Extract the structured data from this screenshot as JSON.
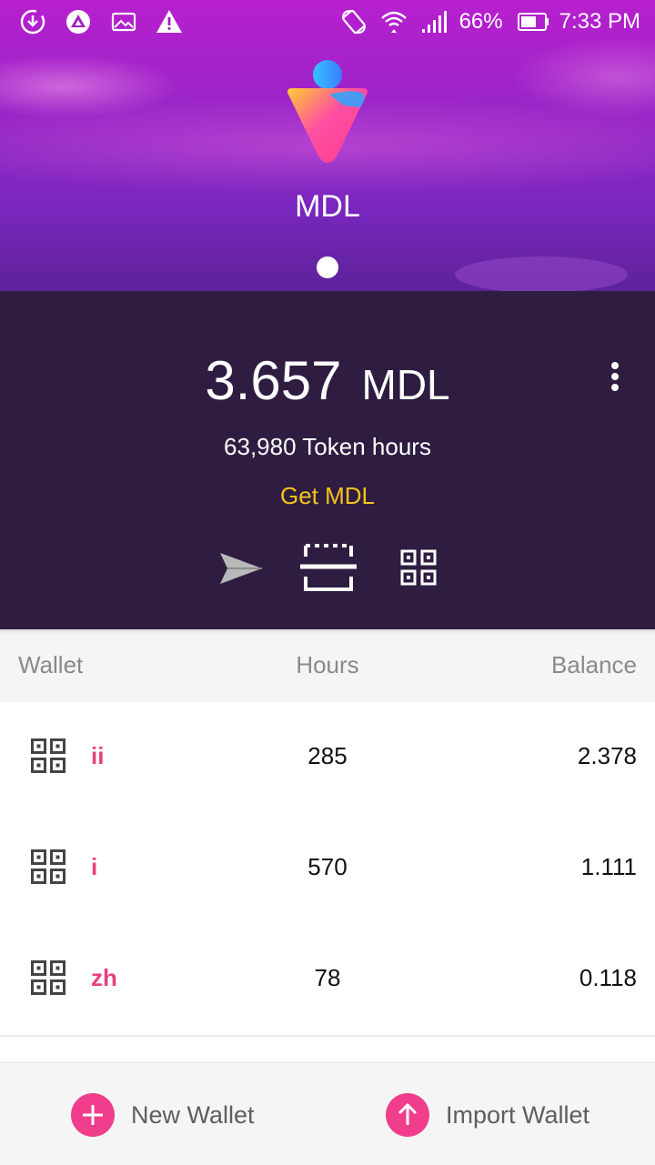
{
  "status_bar": {
    "battery_percent": "66%",
    "time": "7:33 PM",
    "icons_left": [
      "download-icon",
      "app-icon",
      "image-icon",
      "warning-icon"
    ],
    "icons_right": [
      "rotate-icon",
      "wifi-icon",
      "signal-icon",
      "battery-icon"
    ]
  },
  "header": {
    "coin_name": "MDL"
  },
  "summary": {
    "amount": "3.657",
    "unit": "MDL",
    "token_hours": "63,980 Token hours",
    "get_link": "Get MDL",
    "actions": [
      "send-icon",
      "scan-icon",
      "qr-code-icon"
    ]
  },
  "table": {
    "headers": {
      "wallet": "Wallet",
      "hours": "Hours",
      "balance": "Balance"
    },
    "rows": [
      {
        "name": "ii",
        "hours": "285",
        "balance": "2.378"
      },
      {
        "name": "i",
        "hours": "570",
        "balance": "1.111"
      },
      {
        "name": "zh",
        "hours": "78",
        "balance": "0.118"
      }
    ]
  },
  "footer": {
    "new_wallet": "New Wallet",
    "import_wallet": "Import Wallet"
  },
  "colors": {
    "accent_pink": "#f03e8c",
    "wallet_name": "#e8407e",
    "get_link": "#f7c21b",
    "summary_bg": "#2e1d41",
    "hero_top": "#b81fcf",
    "hero_bottom": "#5d2299"
  }
}
